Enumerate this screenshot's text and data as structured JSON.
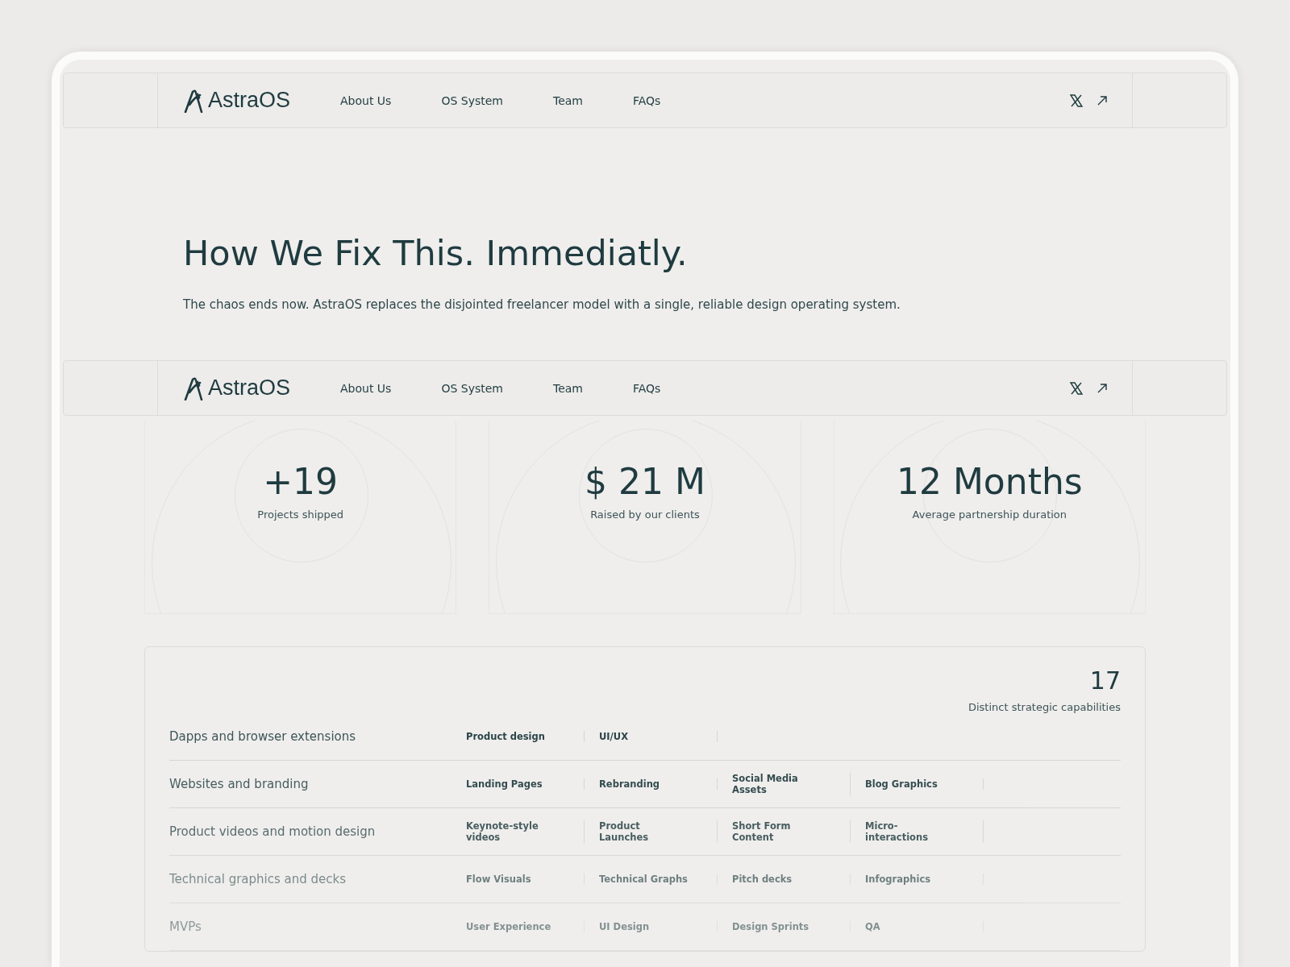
{
  "navbars": [
    {
      "brand": "AstraOS",
      "links": [
        "About Us",
        "OS System",
        "Team",
        "FAQs"
      ]
    },
    {
      "brand": "AstraOS",
      "links": [
        "About Us",
        "OS System",
        "Team",
        "FAQs"
      ]
    }
  ],
  "hero": {
    "title": "How We Fix This. Immediatly.",
    "subtitle": "The chaos ends now. AstraOS replaces the disjointed freelancer model with a single, reliable design operating system."
  },
  "stats": [
    {
      "value": "+19",
      "label": "Projects shipped"
    },
    {
      "value": "$ 21 M",
      "label": "Raised by our clients"
    },
    {
      "value": "12 Months",
      "label": "Average partnership duration"
    }
  ],
  "capabilities": {
    "count": "17",
    "count_label": "Distinct strategic capabilities",
    "rows": [
      {
        "name": "Dapps and browser extensions",
        "tags": [
          "Product design",
          "UI/UX"
        ]
      },
      {
        "name": "Websites and branding",
        "tags": [
          "Landing Pages",
          "Rebranding",
          "Social Media Assets",
          "Blog Graphics"
        ]
      },
      {
        "name": "Product videos and motion design",
        "tags": [
          "Keynote-style videos",
          "Product Launches",
          "Short Form Content",
          "Micro-interactions"
        ]
      },
      {
        "name": "Technical graphics and decks",
        "tags": [
          "Flow Visuals",
          "Technical Graphs",
          "Pitch decks",
          "Infographics"
        ]
      },
      {
        "name": "MVPs",
        "tags": [
          "User Experience",
          "UI Design",
          "Design Sprints",
          "QA"
        ]
      }
    ]
  }
}
